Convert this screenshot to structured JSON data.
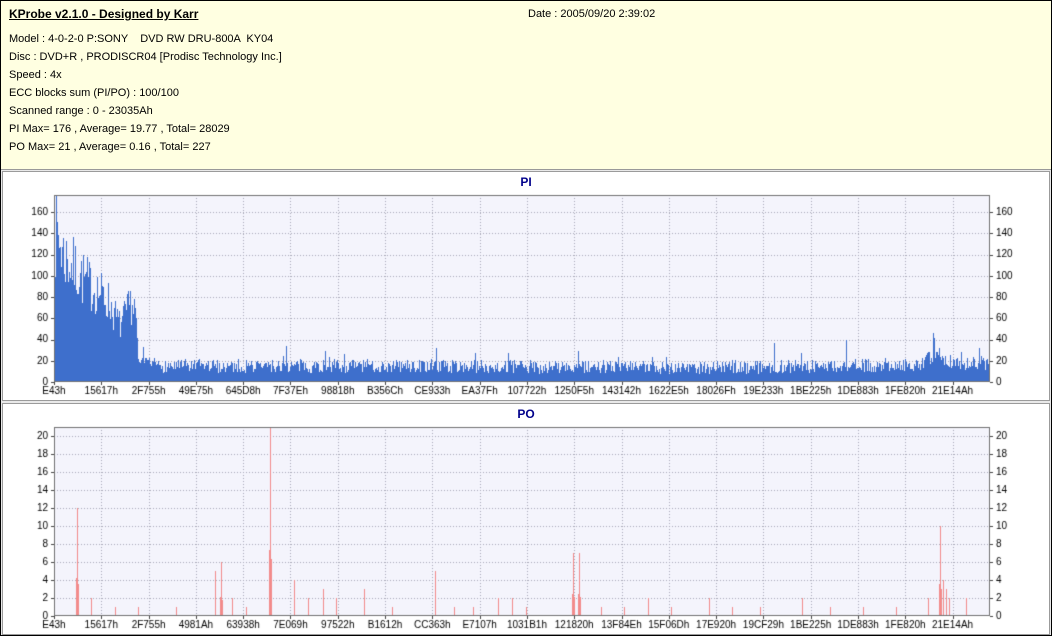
{
  "header": {
    "app_title": "KProbe v2.1.0 - Designed by Karr",
    "date_label": "Date : 2005/09/20 2:39:02",
    "info_lines": [
      "Model : 4-0-2-0 P:SONY    DVD RW DRU-800A  KY04",
      "Disc : DVD+R , PRODISCR04 [Prodisc Technology Inc.]",
      "Speed : 4x",
      "ECC blocks sum (PI/PO) : 100/100",
      "Scanned range : 0 - 23035Ah",
      "PI Max= 176 , Average= 19.77 , Total= 28029",
      "PO Max= 21 , Average= 0.16 , Total= 227"
    ]
  },
  "chart_data": [
    {
      "id": "pi",
      "type": "bar",
      "title": "PI",
      "seed": 7,
      "bar_color": "#3E6FCC",
      "plot_bg": "#F4F4FC",
      "title_color": "#00008B",
      "grid": true,
      "legend": false,
      "ylim": [
        0,
        176
      ],
      "y_ticks": [
        0,
        20,
        40,
        60,
        80,
        100,
        120,
        140,
        160
      ],
      "x_labels": [
        "E43h",
        "15617h",
        "2F755h",
        "49E75h",
        "645D8h",
        "7F37Eh",
        "98818h",
        "B356Ch",
        "CE933h",
        "EA37Fh",
        "107722h",
        "1250F5h",
        "143142h",
        "1622E5h",
        "18026Fh",
        "19E233h",
        "1BE225h",
        "1DE883h",
        "1FE820h",
        "21E14Ah"
      ],
      "x_label_span": 0.96,
      "stats": {
        "max": 176,
        "average": 19.77,
        "total": 28029
      },
      "envelope": [
        [
          0,
          150
        ],
        [
          0.004,
          160
        ],
        [
          0.01,
          138
        ],
        [
          0.018,
          128
        ],
        [
          0.028,
          116
        ],
        [
          0.038,
          106
        ],
        [
          0.048,
          98
        ],
        [
          0.058,
          88
        ],
        [
          0.065,
          72
        ],
        [
          0.07,
          62
        ],
        [
          0.076,
          72
        ],
        [
          0.082,
          86
        ],
        [
          0.087,
          78
        ],
        [
          0.0895,
          17
        ],
        [
          0.12,
          15
        ],
        [
          0.25,
          15
        ],
        [
          0.4,
          15
        ],
        [
          0.55,
          14
        ],
        [
          0.7,
          14
        ],
        [
          0.85,
          15
        ],
        [
          0.925,
          17
        ],
        [
          0.94,
          24
        ],
        [
          0.95,
          22
        ],
        [
          0.97,
          17
        ],
        [
          1,
          18
        ]
      ],
      "spikes": [
        [
          0.002,
          176
        ],
        [
          0.248,
          34
        ],
        [
          0.31,
          26
        ],
        [
          0.45,
          27
        ],
        [
          0.56,
          29
        ],
        [
          0.655,
          24
        ],
        [
          0.94,
          38
        ],
        [
          0.947,
          32
        ]
      ]
    },
    {
      "id": "po",
      "type": "bar",
      "title": "PO",
      "seed": 9,
      "bar_color": "#F28B8B",
      "plot_bg": "#F4F4FC",
      "title_color": "#00008B",
      "grid": true,
      "legend": false,
      "ylim": [
        0,
        21
      ],
      "y_ticks": [
        0,
        2,
        4,
        6,
        8,
        10,
        12,
        14,
        16,
        18,
        20
      ],
      "x_labels": [
        "E43h",
        "15617h",
        "2F755h",
        "4981Ah",
        "63938h",
        "7E069h",
        "97522h",
        "B1612h",
        "CC363h",
        "E7107h",
        "1031B1h",
        "121820h",
        "13F84Eh",
        "15F06Dh",
        "17E920h",
        "19CF29h",
        "1BE225h",
        "1DE883h",
        "1FE820h",
        "21E14Ah"
      ],
      "x_label_span": 0.96,
      "stats": {
        "max": 21,
        "average": 0.16,
        "total": 227
      },
      "spikes": [
        [
          0.0245,
          12
        ],
        [
          0.04,
          2
        ],
        [
          0.065,
          1
        ],
        [
          0.09,
          1
        ],
        [
          0.13,
          1
        ],
        [
          0.172,
          5
        ],
        [
          0.179,
          6
        ],
        [
          0.19,
          2
        ],
        [
          0.205,
          1
        ],
        [
          0.231,
          21
        ],
        [
          0.257,
          4
        ],
        [
          0.272,
          2
        ],
        [
          0.288,
          3
        ],
        [
          0.302,
          2
        ],
        [
          0.332,
          3
        ],
        [
          0.362,
          1
        ],
        [
          0.408,
          5
        ],
        [
          0.428,
          1
        ],
        [
          0.448,
          1
        ],
        [
          0.475,
          2
        ],
        [
          0.49,
          2
        ],
        [
          0.505,
          1
        ],
        [
          0.555,
          7
        ],
        [
          0.561,
          7
        ],
        [
          0.585,
          1
        ],
        [
          0.61,
          1
        ],
        [
          0.635,
          2
        ],
        [
          0.66,
          1
        ],
        [
          0.7,
          2
        ],
        [
          0.725,
          1
        ],
        [
          0.755,
          1
        ],
        [
          0.8,
          2
        ],
        [
          0.83,
          1
        ],
        [
          0.865,
          1
        ],
        [
          0.9,
          1
        ],
        [
          0.935,
          2
        ],
        [
          0.948,
          10
        ],
        [
          0.951,
          4
        ],
        [
          0.954,
          3
        ],
        [
          0.957,
          2
        ],
        [
          0.975,
          2
        ]
      ]
    }
  ]
}
